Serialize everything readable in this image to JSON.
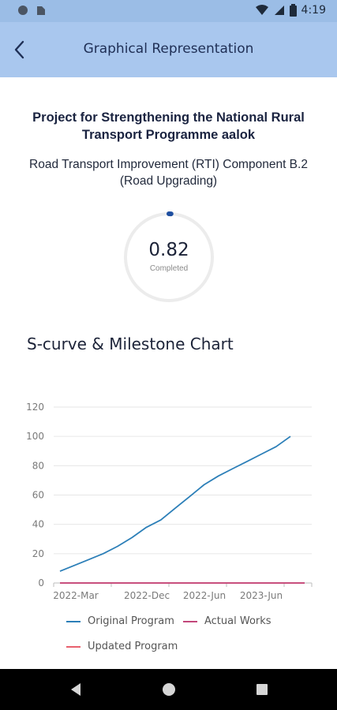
{
  "status_bar": {
    "time": "4:19",
    "icons": [
      "circle-icon",
      "sim-icon",
      "wifi-icon",
      "signal-icon",
      "battery-icon"
    ]
  },
  "app_bar": {
    "title": "Graphical Representation",
    "back_icon": "chevron-left-icon"
  },
  "project": {
    "title": "Project for Strengthening the National Rural Transport Programme aalok",
    "component": "Road Transport Improvement (RTI) Component B.2 (Road Upgrading)"
  },
  "progress": {
    "value": "0.82",
    "label": "Completed",
    "fraction": 0.0082
  },
  "chart_heading": "S-curve & Milestone Chart",
  "chart_data": {
    "type": "line",
    "title": "",
    "xlabel": "",
    "ylabel": "",
    "ylim": [
      0,
      120
    ],
    "yticks": [
      0,
      20,
      40,
      60,
      80,
      100,
      120
    ],
    "x_tick_labels": [
      "2022-Mar",
      "2022-Dec",
      "2022-Jun",
      "2023-Jun"
    ],
    "grid": true,
    "legend_position": "bottom",
    "series": [
      {
        "name": "Original Program",
        "color": "#2c7fb8",
        "values": [
          8,
          12,
          16,
          20,
          25,
          31,
          38,
          43,
          51,
          59,
          67,
          73,
          78,
          83,
          88,
          93,
          100
        ]
      },
      {
        "name": "Actual Works",
        "color": "#c2477a",
        "values": [
          0,
          0,
          0,
          0,
          0,
          0,
          0,
          0,
          0,
          0,
          0,
          0,
          0,
          0,
          0,
          0,
          0,
          0,
          0,
          0
        ]
      },
      {
        "name": "Updated Program",
        "color": "#e8606e",
        "values": [
          0,
          0,
          0,
          0,
          0,
          0,
          0,
          0,
          0,
          0,
          0,
          0,
          0,
          0,
          0,
          0,
          0,
          0,
          0,
          0
        ]
      }
    ]
  },
  "nav_bar": {
    "icons": [
      "back-triangle-icon",
      "home-circle-icon",
      "recents-square-icon"
    ]
  }
}
